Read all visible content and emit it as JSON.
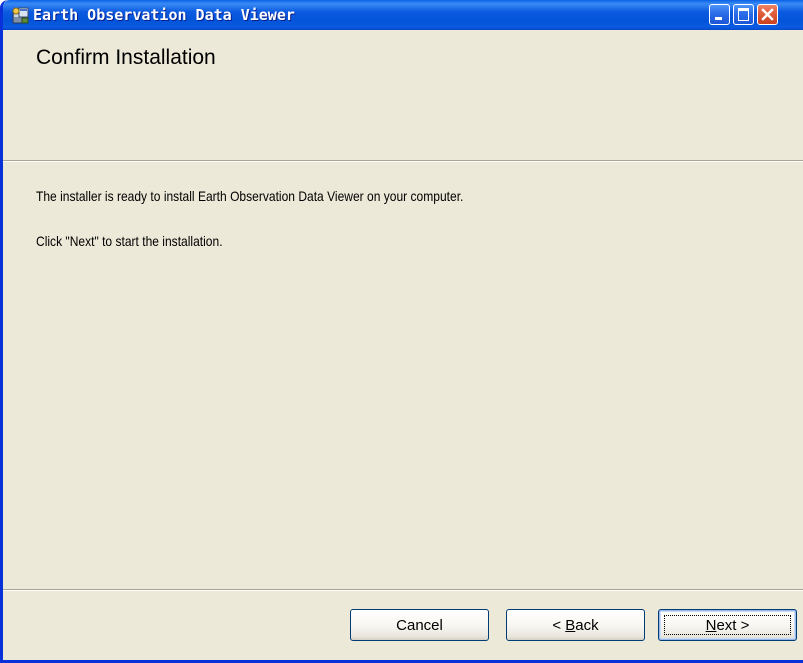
{
  "window": {
    "title": "Earth Observation Data Viewer"
  },
  "page": {
    "title": "Confirm Installation",
    "line1": "The installer is ready to install Earth Observation Data Viewer on your computer.",
    "line2": "Click \"Next\" to start the installation."
  },
  "buttons": {
    "cancel": "Cancel",
    "back_prefix": "< ",
    "back_mnemonic": "B",
    "back_rest": "ack",
    "next_mnemonic": "N",
    "next_rest": "ext >"
  },
  "icons": {
    "app": "installer-icon",
    "minimize": "minimize-icon",
    "maximize": "maximize-icon",
    "close": "close-icon"
  },
  "colors": {
    "titlebar": "#0454D9",
    "window_bg": "#ECE9D8",
    "close_button": "#E05B3A",
    "button_border": "#003C74"
  }
}
